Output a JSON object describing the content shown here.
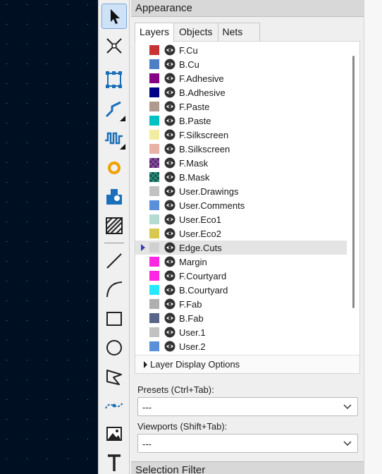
{
  "panel": {
    "title": "Appearance",
    "bottom_title": "Selection Filter",
    "tabs": [
      {
        "label": "Layers",
        "active": true
      },
      {
        "label": "Objects",
        "active": false
      },
      {
        "label": "Nets",
        "active": false
      }
    ]
  },
  "layers": [
    {
      "name": "F.Cu",
      "color": "#c83434"
    },
    {
      "name": "B.Cu",
      "color": "#4d7fc4"
    },
    {
      "name": "F.Adhesive",
      "color": "#840084"
    },
    {
      "name": "B.Adhesive",
      "color": "#000084"
    },
    {
      "name": "F.Paste",
      "color": "#b09a8f"
    },
    {
      "name": "B.Paste",
      "color": "#00c2c2"
    },
    {
      "name": "F.Silkscreen",
      "color": "#f2eda1"
    },
    {
      "name": "B.Silkscreen",
      "color": "#e8b2a7"
    },
    {
      "name": "F.Mask",
      "color": "#5a2a6e",
      "color2": "#8a4fa0",
      "pattern": "checker"
    },
    {
      "name": "B.Mask",
      "color": "#0f5a4f",
      "color2": "#2f8a7c",
      "pattern": "checker"
    },
    {
      "name": "User.Drawings",
      "color": "#c2c2c2"
    },
    {
      "name": "User.Comments",
      "color": "#5990dc"
    },
    {
      "name": "User.Eco1",
      "color": "#b4dbd2"
    },
    {
      "name": "User.Eco2",
      "color": "#d8c852"
    },
    {
      "name": "Edge.Cuts",
      "color": "#d0d0d0",
      "selected": true
    },
    {
      "name": "Margin",
      "color": "#ff26e2"
    },
    {
      "name": "F.Courtyard",
      "color": "#ff26e2"
    },
    {
      "name": "B.Courtyard",
      "color": "#26e9ff"
    },
    {
      "name": "F.Fab",
      "color": "#afafaf"
    },
    {
      "name": "B.Fab",
      "color": "#58658a"
    },
    {
      "name": "User.1",
      "color": "#c2c2c2"
    },
    {
      "name": "User.2",
      "color": "#5990dc"
    }
  ],
  "layer_display_options": "Layer Display Options",
  "presets": {
    "label": "Presets (Ctrl+Tab):",
    "value": "---"
  },
  "viewports": {
    "label": "Viewports (Shift+Tab):",
    "value": "---"
  },
  "toolbar": {
    "tools": [
      {
        "icon": "select-arrow-icon",
        "active": true
      },
      {
        "icon": "local-ratsnest-icon"
      },
      {
        "icon": "add-footprint-icon"
      },
      {
        "icon": "route-track-icon",
        "submenu": true
      },
      {
        "icon": "tune-length-icon",
        "submenu": true
      },
      {
        "icon": "add-via-icon"
      },
      {
        "icon": "add-zone-icon"
      },
      {
        "icon": "rule-area-icon"
      },
      {
        "icon": "draw-line-icon"
      },
      {
        "icon": "draw-arc-icon"
      },
      {
        "icon": "draw-rectangle-icon"
      },
      {
        "icon": "draw-circle-icon"
      },
      {
        "icon": "draw-polygon-icon"
      },
      {
        "icon": "draw-bezier-icon"
      },
      {
        "icon": "add-image-icon"
      },
      {
        "icon": "add-text-icon"
      }
    ]
  },
  "colors": {
    "canvas_bg": "#001023",
    "selection_marker": "#3a3ac8",
    "active_tool_bg": "#cde1f7"
  }
}
